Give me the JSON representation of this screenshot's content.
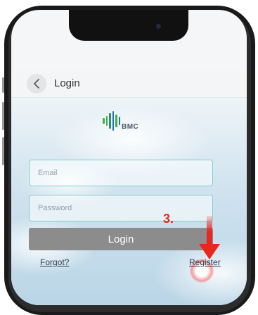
{
  "header": {
    "title": "Login"
  },
  "logo": {
    "text": "BMC"
  },
  "form": {
    "email_placeholder": "Email",
    "password_placeholder": "Password",
    "login_label": "Login",
    "forgot_label": "Forgot?",
    "register_label": "Register"
  },
  "annotation": {
    "step_label": "3."
  },
  "colors": {
    "field_border": "#7fd0c6",
    "login_button": "#8c8c8c",
    "annotation_red": "#e8281e",
    "logo_green": "#3bb24a",
    "logo_blue": "#2a6fb8"
  }
}
